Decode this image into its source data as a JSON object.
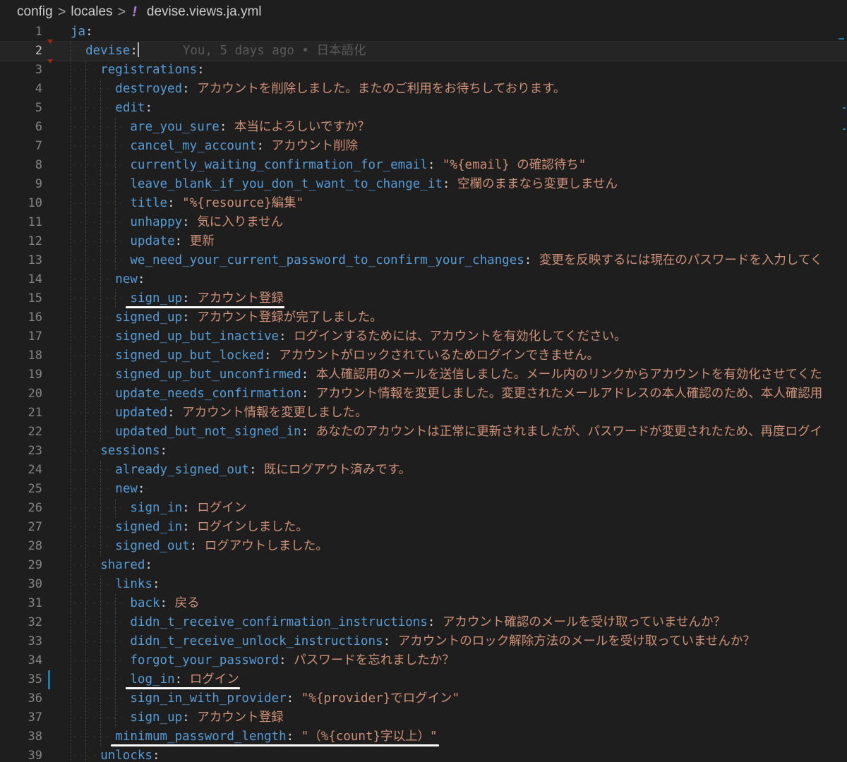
{
  "breadcrumb": {
    "items": [
      "config",
      "locales"
    ],
    "separator": ">",
    "file_icon": "!",
    "file_name": "devise.views.ja.yml"
  },
  "blame": "You, 5 days ago • 日本語化",
  "lines": [
    {
      "n": "1",
      "indent": 0,
      "key": "ja",
      "value": ""
    },
    {
      "n": "2",
      "indent": 1,
      "key": "devise",
      "value": "",
      "current": true
    },
    {
      "n": "3",
      "indent": 2,
      "key": "registrations",
      "value": ""
    },
    {
      "n": "4",
      "indent": 3,
      "key": "destroyed",
      "value": "アカウントを削除しました。またのご利用をお待ちしております。"
    },
    {
      "n": "5",
      "indent": 3,
      "key": "edit",
      "value": ""
    },
    {
      "n": "6",
      "indent": 4,
      "key": "are_you_sure",
      "value": "本当によろしいですか？"
    },
    {
      "n": "7",
      "indent": 4,
      "key": "cancel_my_account",
      "value": "アカウント削除"
    },
    {
      "n": "8",
      "indent": 4,
      "key": "currently_waiting_confirmation_for_email",
      "value": "\"%{email} の確認待ち\""
    },
    {
      "n": "9",
      "indent": 4,
      "key": "leave_blank_if_you_don_t_want_to_change_it",
      "value": "空欄のままなら変更しません"
    },
    {
      "n": "10",
      "indent": 4,
      "key": "title",
      "value": "\"%{resource}編集\""
    },
    {
      "n": "11",
      "indent": 4,
      "key": "unhappy",
      "value": "気に入りません"
    },
    {
      "n": "12",
      "indent": 4,
      "key": "update",
      "value": "更新"
    },
    {
      "n": "13",
      "indent": 4,
      "key": "we_need_your_current_password_to_confirm_your_changes",
      "value": "変更を反映するには現在のパスワードを入力してく"
    },
    {
      "n": "14",
      "indent": 3,
      "key": "new",
      "value": ""
    },
    {
      "n": "15",
      "indent": 4,
      "key": "sign_up",
      "value": "アカウント登録",
      "underline": true
    },
    {
      "n": "16",
      "indent": 3,
      "key": "signed_up",
      "value": "アカウント登録が完了しました。"
    },
    {
      "n": "17",
      "indent": 3,
      "key": "signed_up_but_inactive",
      "value": "ログインするためには、アカウントを有効化してください。"
    },
    {
      "n": "18",
      "indent": 3,
      "key": "signed_up_but_locked",
      "value": "アカウントがロックされているためログインできません。"
    },
    {
      "n": "19",
      "indent": 3,
      "key": "signed_up_but_unconfirmed",
      "value": "本人確認用のメールを送信しました。メール内のリンクからアカウントを有効化させてくた"
    },
    {
      "n": "20",
      "indent": 3,
      "key": "update_needs_confirmation",
      "value": "アカウント情報を変更しました。変更されたメールアドレスの本人確認のため、本人確認用"
    },
    {
      "n": "21",
      "indent": 3,
      "key": "updated",
      "value": "アカウント情報を変更しました。"
    },
    {
      "n": "22",
      "indent": 3,
      "key": "updated_but_not_signed_in",
      "value": "あなたのアカウントは正常に更新されましたが、パスワードが変更されたため、再度ログイ"
    },
    {
      "n": "23",
      "indent": 2,
      "key": "sessions",
      "value": ""
    },
    {
      "n": "24",
      "indent": 3,
      "key": "already_signed_out",
      "value": "既にログアウト済みです。"
    },
    {
      "n": "25",
      "indent": 3,
      "key": "new",
      "value": ""
    },
    {
      "n": "26",
      "indent": 4,
      "key": "sign_in",
      "value": "ログイン"
    },
    {
      "n": "27",
      "indent": 3,
      "key": "signed_in",
      "value": "ログインしました。"
    },
    {
      "n": "28",
      "indent": 3,
      "key": "signed_out",
      "value": "ログアウトしました。"
    },
    {
      "n": "29",
      "indent": 2,
      "key": "shared",
      "value": ""
    },
    {
      "n": "30",
      "indent": 3,
      "key": "links",
      "value": ""
    },
    {
      "n": "31",
      "indent": 4,
      "key": "back",
      "value": "戻る"
    },
    {
      "n": "32",
      "indent": 4,
      "key": "didn_t_receive_confirmation_instructions",
      "value": "アカウント確認のメールを受け取っていませんか？"
    },
    {
      "n": "33",
      "indent": 4,
      "key": "didn_t_receive_unlock_instructions",
      "value": "アカウントのロック解除方法のメールを受け取っていませんか？"
    },
    {
      "n": "34",
      "indent": 4,
      "key": "forgot_your_password",
      "value": "パスワードを忘れましたか？"
    },
    {
      "n": "35",
      "indent": 4,
      "key": "log_in",
      "value": "ログイン",
      "underline": true,
      "modified": true
    },
    {
      "n": "36",
      "indent": 4,
      "key": "sign_in_with_provider",
      "value": "\"%{provider}でログイン\""
    },
    {
      "n": "37",
      "indent": 4,
      "key": "sign_up",
      "value": "アカウント登録"
    },
    {
      "n": "38",
      "indent": 3,
      "key": "minimum_password_length",
      "value": "\"（%{count}字以上）\"",
      "underline": true
    },
    {
      "n": "39",
      "indent": 2,
      "key": "unlocks",
      "value": ""
    }
  ],
  "colors": {
    "background": "#1e1e1e",
    "key": "#569cd6",
    "string": "#ce9178",
    "line_number": "#858585",
    "modified_bar": "#1b81a8"
  }
}
